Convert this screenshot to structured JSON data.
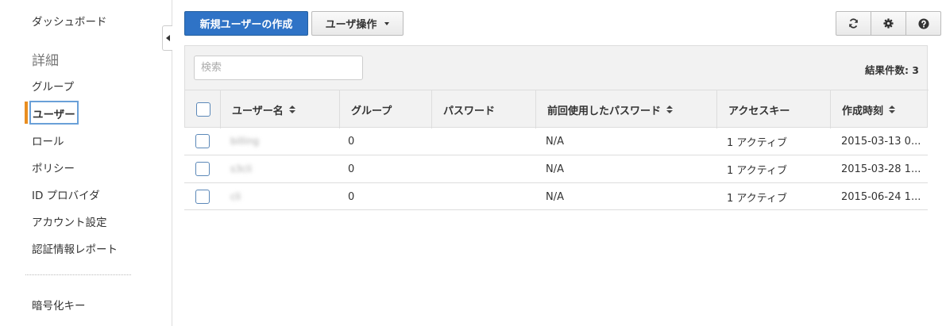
{
  "sidebar": {
    "items_top": [
      "ダッシュボード"
    ],
    "section_title": "詳細",
    "items": [
      "グループ",
      "ユーザー",
      "ロール",
      "ポリシー",
      "ID プロバイダ",
      "アカウント設定",
      "認証情報レポート"
    ],
    "items_bottom": [
      "暗号化キー"
    ]
  },
  "toolbar": {
    "create_user": "新規ユーザーの作成",
    "user_actions": "ユーザ操作",
    "icons": [
      "refresh-icon",
      "gear-icon",
      "help-icon"
    ]
  },
  "search": {
    "placeholder": "検索"
  },
  "results": {
    "label": "結果件数: 3"
  },
  "table": {
    "headers": [
      "ユーザー名",
      "グループ",
      "パスワード",
      "前回使用したパスワード",
      "アクセスキー",
      "作成時刻"
    ],
    "rows": [
      {
        "username": "billing",
        "groups": "0",
        "password": "",
        "last_used": "N/A",
        "access_keys": "1 アクティブ",
        "created": "2015-03-13 0..."
      },
      {
        "username": "s3cli",
        "groups": "0",
        "password": "",
        "last_used": "N/A",
        "access_keys": "1 アクティブ",
        "created": "2015-03-28 1..."
      },
      {
        "username": "cli",
        "groups": "0",
        "password": "",
        "last_used": "N/A",
        "access_keys": "1 アクティブ",
        "created": "2015-06-24 1..."
      }
    ]
  },
  "colors": {
    "primary": "#2f73c6",
    "active_bar": "#e98e21",
    "focus_outline": "#6aa0d8"
  }
}
